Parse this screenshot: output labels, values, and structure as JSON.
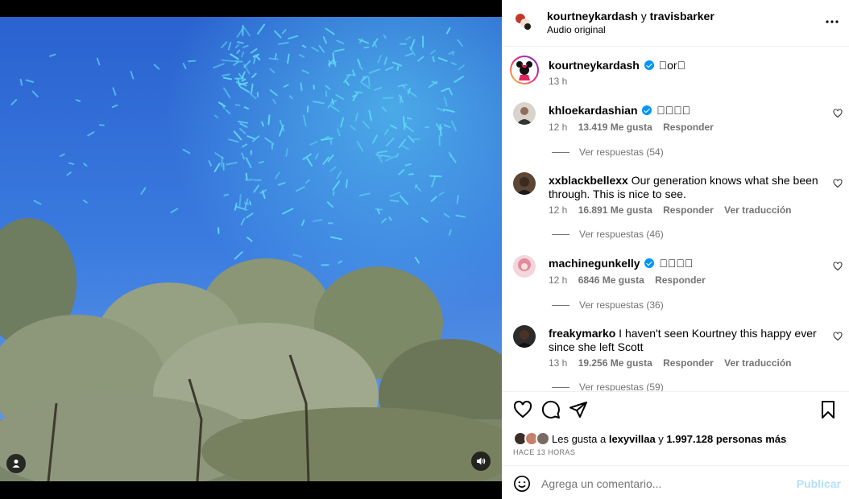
{
  "header": {
    "user1": "kourtneykardash",
    "separator": "y",
    "user2": "travisbarker",
    "subtitle": "Audio original"
  },
  "caption": {
    "username": "kourtneykardash",
    "text": "\u0000or\u0000",
    "time": "13 h"
  },
  "comments": [
    {
      "username": "khloekardashian",
      "verified": true,
      "text": "\u0000\u0000\u0000\u0000",
      "time": "12 h",
      "likes": "13.419 Me gusta",
      "reply": "Responder",
      "translate": "",
      "replies": "Ver respuestas (54)"
    },
    {
      "username": "xxblackbellexx",
      "verified": false,
      "text": "Our generation knows what she been through. This is nice to see.",
      "time": "12 h",
      "likes": "16.891 Me gusta",
      "reply": "Responder",
      "translate": "Ver traducción",
      "replies": "Ver respuestas (46)"
    },
    {
      "username": "machinegunkelly",
      "verified": true,
      "text": "\u0000\u0000\u0000\u0000",
      "time": "12 h",
      "likes": "6846 Me gusta",
      "reply": "Responder",
      "translate": "",
      "replies": "Ver respuestas (36)"
    },
    {
      "username": "freakymarko",
      "verified": false,
      "text": "I haven't seen Kourtney this happy ever since she left Scott",
      "time": "13 h",
      "likes": "19.256 Me gusta",
      "reply": "Responder",
      "translate": "Ver traducción",
      "replies": "Ver respuestas (59)"
    }
  ],
  "likes": {
    "prefix": "Les gusta a",
    "user": "lexyvillaa",
    "conj": "y",
    "others": "1.997.128 personas más"
  },
  "posted": "HACE 13 HORAS",
  "add_comment": {
    "placeholder": "Agrega un comentario...",
    "publish": "Publicar"
  },
  "colors": {
    "verified": "#0095f6",
    "publish_disabled": "#b2dffc",
    "sky": "#2f6fd6",
    "confetti": "#5ad6f5"
  }
}
